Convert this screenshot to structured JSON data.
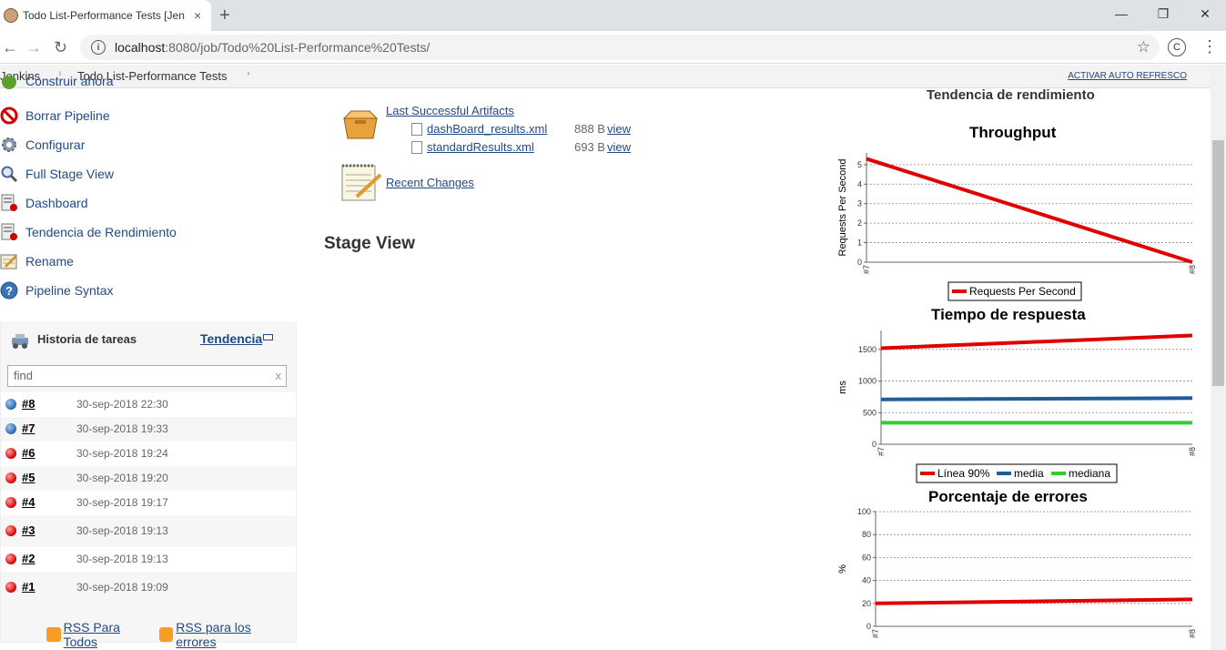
{
  "browser": {
    "tab_title": "Todo List-Performance Tests [Jenkins]",
    "tab_close": "×",
    "new_tab": "+",
    "url_host": "localhost",
    "url_path": ":8080/job/Todo%20List-Performance%20Tests/",
    "profile_initial": "C",
    "win_minimize": "—",
    "win_restore": "❐",
    "win_close": "✕"
  },
  "breadcrumb": {
    "items": [
      "Jenkins",
      "Todo List-Performance Tests"
    ],
    "auto_refresh": "ACTIVAR AUTO REFRESCO"
  },
  "sidebar": {
    "tasks": [
      {
        "label": "Construir ahora",
        "icon": "build-icon"
      },
      {
        "label": "Borrar Pipeline",
        "icon": "no-entry-icon"
      },
      {
        "label": "Configurar",
        "icon": "gear-icon"
      },
      {
        "label": "Full Stage View",
        "icon": "magnifier-icon"
      },
      {
        "label": "Dashboard",
        "icon": "report-icon"
      },
      {
        "label": "Tendencia de Rendimiento",
        "icon": "report-icon"
      },
      {
        "label": "Rename",
        "icon": "notepad-icon"
      },
      {
        "label": "Pipeline Syntax",
        "icon": "help-icon"
      }
    ]
  },
  "history": {
    "title": "Historia de tareas",
    "trend": "Tendencia",
    "filter_placeholder": "find",
    "filter_clear": "x",
    "builds": [
      {
        "num": "#8",
        "date": "30-sep-2018 22:30",
        "status": "blue"
      },
      {
        "num": "#7",
        "date": "30-sep-2018 19:33",
        "status": "blue"
      },
      {
        "num": "#6",
        "date": "30-sep-2018 19:24",
        "status": "red"
      },
      {
        "num": "#5",
        "date": "30-sep-2018 19:20",
        "status": "red"
      },
      {
        "num": "#4",
        "date": "30-sep-2018 19:17",
        "status": "red"
      },
      {
        "num": "#3",
        "date": "30-sep-2018 19:13",
        "status": "red"
      },
      {
        "num": "#2",
        "date": "30-sep-2018 19:13",
        "status": "red"
      },
      {
        "num": "#1",
        "date": "30-sep-2018 19:09",
        "status": "red"
      }
    ],
    "rss_all": "RSS Para Todos",
    "rss_failures": "RSS para los errores"
  },
  "main": {
    "last_artifacts": "Last Successful Artifacts",
    "files": [
      {
        "name": "dashBoard_results.xml",
        "size": "888 B",
        "view": "view"
      },
      {
        "name": "standardResults.xml",
        "size": "693 B",
        "view": "view"
      }
    ],
    "recent_changes": "Recent Changes",
    "stage_view": "Stage View"
  },
  "trend": {
    "title": "Tendencia de rendimiento"
  },
  "colors": {
    "link": "#204a87",
    "red": "#e00000",
    "blue": "#1f5c99",
    "green": "#33cc33"
  },
  "chart_data": [
    {
      "type": "line",
      "title": "Throughput",
      "ylabel": "Requests Per Second",
      "categories": [
        "#7",
        "#8"
      ],
      "ylim": [
        0,
        5.6
      ],
      "yticks": [
        "0",
        "1",
        "2",
        "3",
        "4",
        "5"
      ],
      "grid": true,
      "legend": "bottom",
      "series": [
        {
          "name": "Requests Per Second",
          "color": "#e00000",
          "values": [
            5.3,
            0.0
          ]
        }
      ]
    },
    {
      "type": "line",
      "title": "Tiempo de respuesta",
      "ylabel": "ms",
      "categories": [
        "#7",
        "#8"
      ],
      "ylim": [
        0,
        1800
      ],
      "yticks": [
        "0",
        "500",
        "1000",
        "1500"
      ],
      "grid": true,
      "legend": "bottom",
      "series": [
        {
          "name": "Línea 90%",
          "color": "#e00000",
          "values": [
            1520,
            1720
          ]
        },
        {
          "name": "media",
          "color": "#1f5c99",
          "values": [
            710,
            730
          ]
        },
        {
          "name": "mediana",
          "color": "#33cc33",
          "values": [
            340,
            340
          ]
        }
      ]
    },
    {
      "type": "line",
      "title": "Porcentaje de errores",
      "ylabel": "%",
      "categories": [
        "#7",
        "#8"
      ],
      "ylim": [
        0,
        100
      ],
      "yticks": [
        "0",
        "20",
        "40",
        "60",
        "80",
        "100"
      ],
      "grid": true,
      "legend": "bottom",
      "series": [
        {
          "color": "#e00000",
          "values": [
            20,
            23.5
          ]
        }
      ]
    }
  ]
}
